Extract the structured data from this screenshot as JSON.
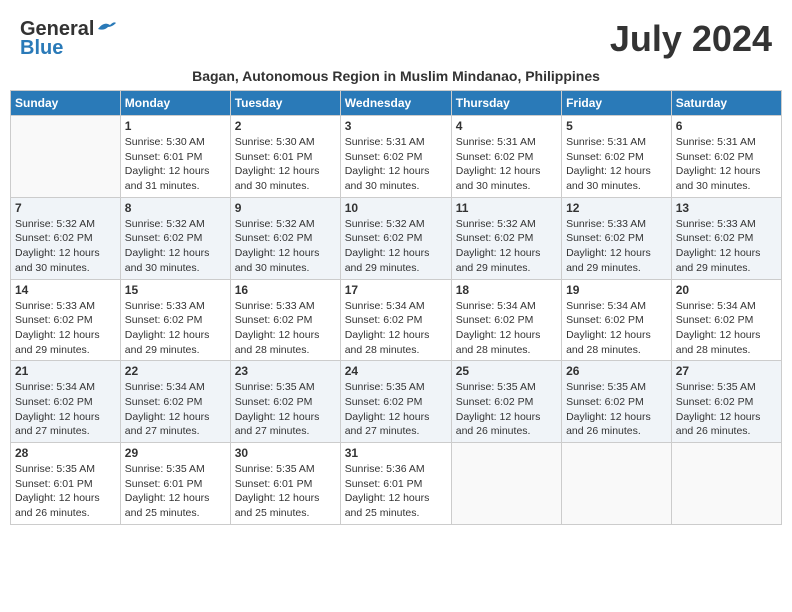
{
  "logo": {
    "general": "General",
    "blue": "Blue"
  },
  "month_title": "July 2024",
  "subtitle": "Bagan, Autonomous Region in Muslim Mindanao, Philippines",
  "headers": [
    "Sunday",
    "Monday",
    "Tuesday",
    "Wednesday",
    "Thursday",
    "Friday",
    "Saturday"
  ],
  "weeks": [
    {
      "shaded": false,
      "days": [
        {
          "num": "",
          "info": ""
        },
        {
          "num": "1",
          "info": "Sunrise: 5:30 AM\nSunset: 6:01 PM\nDaylight: 12 hours\nand 31 minutes."
        },
        {
          "num": "2",
          "info": "Sunrise: 5:30 AM\nSunset: 6:01 PM\nDaylight: 12 hours\nand 30 minutes."
        },
        {
          "num": "3",
          "info": "Sunrise: 5:31 AM\nSunset: 6:02 PM\nDaylight: 12 hours\nand 30 minutes."
        },
        {
          "num": "4",
          "info": "Sunrise: 5:31 AM\nSunset: 6:02 PM\nDaylight: 12 hours\nand 30 minutes."
        },
        {
          "num": "5",
          "info": "Sunrise: 5:31 AM\nSunset: 6:02 PM\nDaylight: 12 hours\nand 30 minutes."
        },
        {
          "num": "6",
          "info": "Sunrise: 5:31 AM\nSunset: 6:02 PM\nDaylight: 12 hours\nand 30 minutes."
        }
      ]
    },
    {
      "shaded": true,
      "days": [
        {
          "num": "7",
          "info": "Sunrise: 5:32 AM\nSunset: 6:02 PM\nDaylight: 12 hours\nand 30 minutes."
        },
        {
          "num": "8",
          "info": "Sunrise: 5:32 AM\nSunset: 6:02 PM\nDaylight: 12 hours\nand 30 minutes."
        },
        {
          "num": "9",
          "info": "Sunrise: 5:32 AM\nSunset: 6:02 PM\nDaylight: 12 hours\nand 30 minutes."
        },
        {
          "num": "10",
          "info": "Sunrise: 5:32 AM\nSunset: 6:02 PM\nDaylight: 12 hours\nand 29 minutes."
        },
        {
          "num": "11",
          "info": "Sunrise: 5:32 AM\nSunset: 6:02 PM\nDaylight: 12 hours\nand 29 minutes."
        },
        {
          "num": "12",
          "info": "Sunrise: 5:33 AM\nSunset: 6:02 PM\nDaylight: 12 hours\nand 29 minutes."
        },
        {
          "num": "13",
          "info": "Sunrise: 5:33 AM\nSunset: 6:02 PM\nDaylight: 12 hours\nand 29 minutes."
        }
      ]
    },
    {
      "shaded": false,
      "days": [
        {
          "num": "14",
          "info": "Sunrise: 5:33 AM\nSunset: 6:02 PM\nDaylight: 12 hours\nand 29 minutes."
        },
        {
          "num": "15",
          "info": "Sunrise: 5:33 AM\nSunset: 6:02 PM\nDaylight: 12 hours\nand 29 minutes."
        },
        {
          "num": "16",
          "info": "Sunrise: 5:33 AM\nSunset: 6:02 PM\nDaylight: 12 hours\nand 28 minutes."
        },
        {
          "num": "17",
          "info": "Sunrise: 5:34 AM\nSunset: 6:02 PM\nDaylight: 12 hours\nand 28 minutes."
        },
        {
          "num": "18",
          "info": "Sunrise: 5:34 AM\nSunset: 6:02 PM\nDaylight: 12 hours\nand 28 minutes."
        },
        {
          "num": "19",
          "info": "Sunrise: 5:34 AM\nSunset: 6:02 PM\nDaylight: 12 hours\nand 28 minutes."
        },
        {
          "num": "20",
          "info": "Sunrise: 5:34 AM\nSunset: 6:02 PM\nDaylight: 12 hours\nand 28 minutes."
        }
      ]
    },
    {
      "shaded": true,
      "days": [
        {
          "num": "21",
          "info": "Sunrise: 5:34 AM\nSunset: 6:02 PM\nDaylight: 12 hours\nand 27 minutes."
        },
        {
          "num": "22",
          "info": "Sunrise: 5:34 AM\nSunset: 6:02 PM\nDaylight: 12 hours\nand 27 minutes."
        },
        {
          "num": "23",
          "info": "Sunrise: 5:35 AM\nSunset: 6:02 PM\nDaylight: 12 hours\nand 27 minutes."
        },
        {
          "num": "24",
          "info": "Sunrise: 5:35 AM\nSunset: 6:02 PM\nDaylight: 12 hours\nand 27 minutes."
        },
        {
          "num": "25",
          "info": "Sunrise: 5:35 AM\nSunset: 6:02 PM\nDaylight: 12 hours\nand 26 minutes."
        },
        {
          "num": "26",
          "info": "Sunrise: 5:35 AM\nSunset: 6:02 PM\nDaylight: 12 hours\nand 26 minutes."
        },
        {
          "num": "27",
          "info": "Sunrise: 5:35 AM\nSunset: 6:02 PM\nDaylight: 12 hours\nand 26 minutes."
        }
      ]
    },
    {
      "shaded": false,
      "days": [
        {
          "num": "28",
          "info": "Sunrise: 5:35 AM\nSunset: 6:01 PM\nDaylight: 12 hours\nand 26 minutes."
        },
        {
          "num": "29",
          "info": "Sunrise: 5:35 AM\nSunset: 6:01 PM\nDaylight: 12 hours\nand 25 minutes."
        },
        {
          "num": "30",
          "info": "Sunrise: 5:35 AM\nSunset: 6:01 PM\nDaylight: 12 hours\nand 25 minutes."
        },
        {
          "num": "31",
          "info": "Sunrise: 5:36 AM\nSunset: 6:01 PM\nDaylight: 12 hours\nand 25 minutes."
        },
        {
          "num": "",
          "info": ""
        },
        {
          "num": "",
          "info": ""
        },
        {
          "num": "",
          "info": ""
        }
      ]
    }
  ]
}
